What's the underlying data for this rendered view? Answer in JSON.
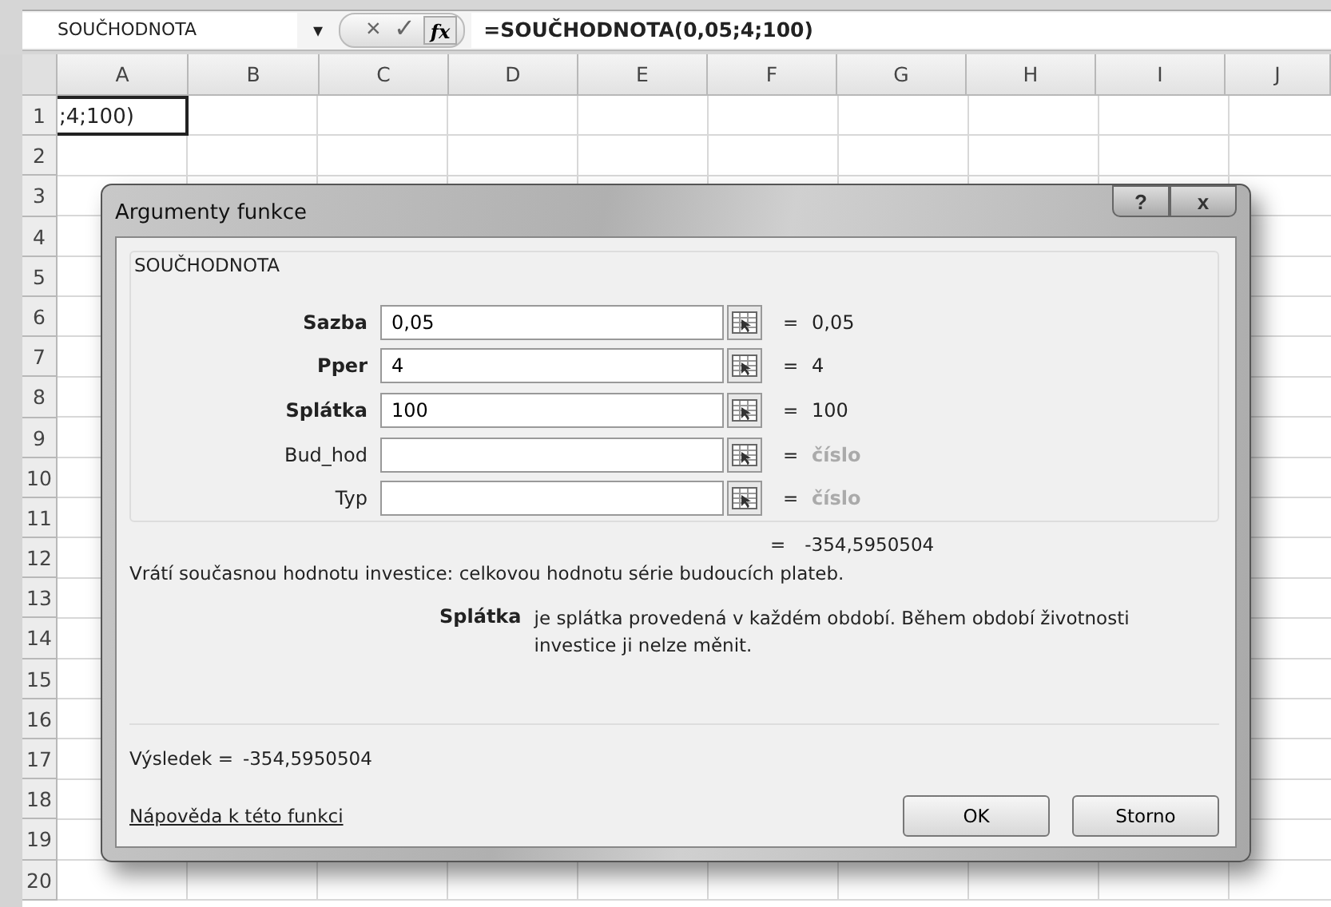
{
  "formula_bar": {
    "name_box": "SOUČHODNOTA",
    "dropdown": "▾",
    "cancel": "×",
    "enter": "✓",
    "fx": "fx",
    "formula": "=SOUČHODNOTA(0,05;4;100)"
  },
  "sheet": {
    "columns": [
      "A",
      "B",
      "C",
      "D",
      "E",
      "F",
      "G",
      "H",
      "I",
      "J"
    ],
    "rows": [
      "1",
      "2",
      "3",
      "4",
      "5",
      "6",
      "7",
      "8",
      "9",
      "10",
      "11",
      "12",
      "13",
      "14",
      "15",
      "16",
      "17",
      "18",
      "19",
      "20"
    ],
    "active_cell": {
      "text": ";4;100)",
      "selected": true
    }
  },
  "dialog": {
    "title": "Argumenty funkce",
    "help": "?",
    "close": "x",
    "function_name": "SOUČHODNOTA",
    "arguments": [
      {
        "label": "Sazba",
        "required": true,
        "value": "0,05",
        "equals": "=",
        "result": "0,05",
        "dimmed": false
      },
      {
        "label": "Pper",
        "required": true,
        "value": "4",
        "equals": "=",
        "result": "4",
        "dimmed": false
      },
      {
        "label": "Splátka",
        "required": true,
        "value": "100",
        "equals": "=",
        "result": "100",
        "dimmed": false
      },
      {
        "label": "Bud_hod",
        "required": false,
        "equals": "=",
        "result": "číslo",
        "dimmed": true
      },
      {
        "label": "Typ",
        "required": false,
        "equals": "=",
        "result": "číslo",
        "dimmed": true
      }
    ],
    "total_equals": "=",
    "total": "-354,5950504",
    "description": "Vrátí současnou hodnotu investice: celkovou hodnotu série budoucích plateb.",
    "argument_help": {
      "name": "Splátka",
      "text": "je splátka provedená v každém období. Během období životnosti investice ji nelze měnit."
    },
    "result_label": "Výsledek =",
    "result_value": "-354,5950504",
    "help_link": "Nápověda k této funkci",
    "buttons": [
      "OK",
      "Storno"
    ]
  }
}
